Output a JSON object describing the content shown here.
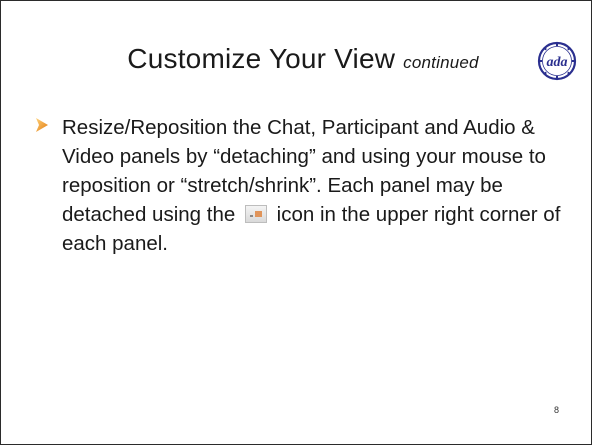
{
  "slide": {
    "title_main": "Customize Your View",
    "title_sub": "continued",
    "logo_text": "ada",
    "bullet": {
      "text_before_icon": "Resize/Reposition the Chat, Participant and Audio & Video panels by “detaching” and using your mouse to reposition or “stretch/shrink”.  Each panel may be detached using the",
      "text_after_icon": "icon in the upper right corner of each panel.",
      "inline_icon": "detach-panel-icon"
    },
    "page_number": "8"
  },
  "colors": {
    "bullet_accent": "#f0a030",
    "logo_blue": "#2a2f8f"
  }
}
